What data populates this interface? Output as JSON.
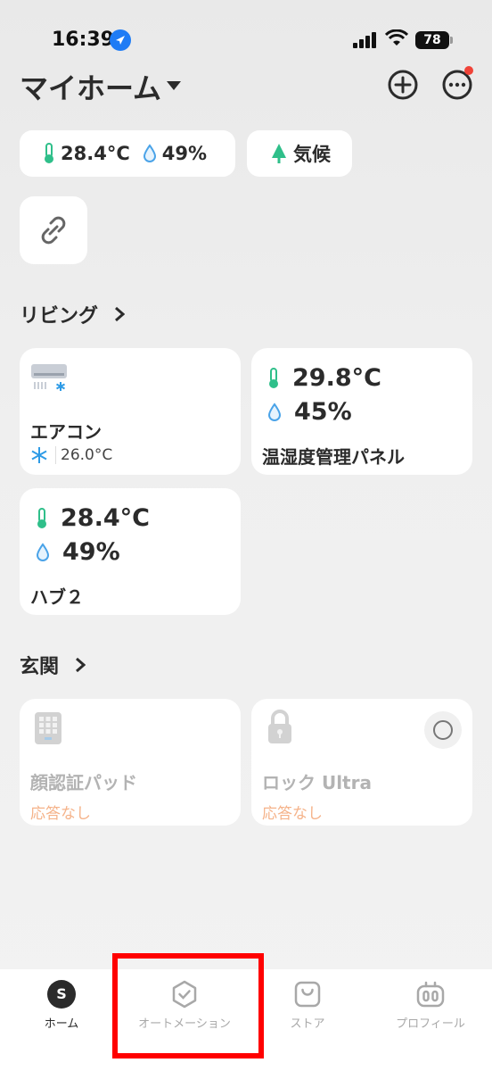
{
  "status_bar": {
    "time": "16:39",
    "battery": "78"
  },
  "header": {
    "title": "マイホーム"
  },
  "chips": {
    "temperature": "28.4°C",
    "humidity": "49%",
    "weather": "気候"
  },
  "sections": [
    {
      "title": "リビング"
    },
    {
      "title": "玄関"
    }
  ],
  "devices": {
    "aircon": {
      "name": "エアコン",
      "setpoint": "26.0°C"
    },
    "panel": {
      "temperature": "29.8°C",
      "humidity": "45%",
      "name": "温湿度管理パネル"
    },
    "hub": {
      "temperature": "28.4°C",
      "humidity": "49%",
      "name": "ハブ２"
    },
    "face_pad": {
      "name": "顔認証パッド",
      "status": "応答なし"
    },
    "lock": {
      "name": "ロック Ultra",
      "status": "応答なし"
    }
  },
  "tabs": [
    {
      "label": "ホーム",
      "avatar": "S"
    },
    {
      "label": "オートメーション"
    },
    {
      "label": "ストア"
    },
    {
      "label": "プロフィール"
    }
  ],
  "colors": {
    "accent_green": "#2fbf8a",
    "water_blue": "#4aa3e8",
    "offline_orange": "#f5b38a",
    "highlight_red": "#ff0000"
  }
}
